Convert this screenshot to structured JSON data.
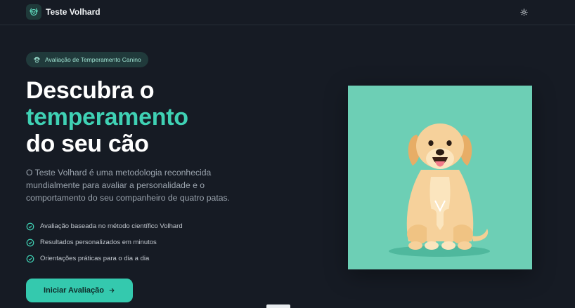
{
  "header": {
    "brand": "Teste Volhard",
    "logo_icon": "dog-face-icon",
    "theme_icon": "sun-icon"
  },
  "hero": {
    "badge": "Avaliação de Temperamento Canino",
    "badge_icon": "paw-icon",
    "headline_line1": "Descubra o",
    "headline_accent": "temperamento",
    "headline_line3": "do seu cão",
    "description": "O Teste Volhard é uma metodologia reconhecida mundialmente para avaliar a personalidade e o comportamento do seu companheiro de quatro patas.",
    "features": [
      "Avaliação baseada no método científico Volhard",
      "Resultados personalizados em minutos",
      "Orientações práticas para o dia a dia"
    ],
    "cta_label": "Iniciar Avaliação",
    "cta_icon": "arrow-right-icon",
    "image_alt": "golden-retriever-illustration"
  },
  "colors": {
    "background": "#161b24",
    "accent": "#3fd1b4",
    "button": "#34c9ae",
    "card": "#6dcfb5"
  }
}
